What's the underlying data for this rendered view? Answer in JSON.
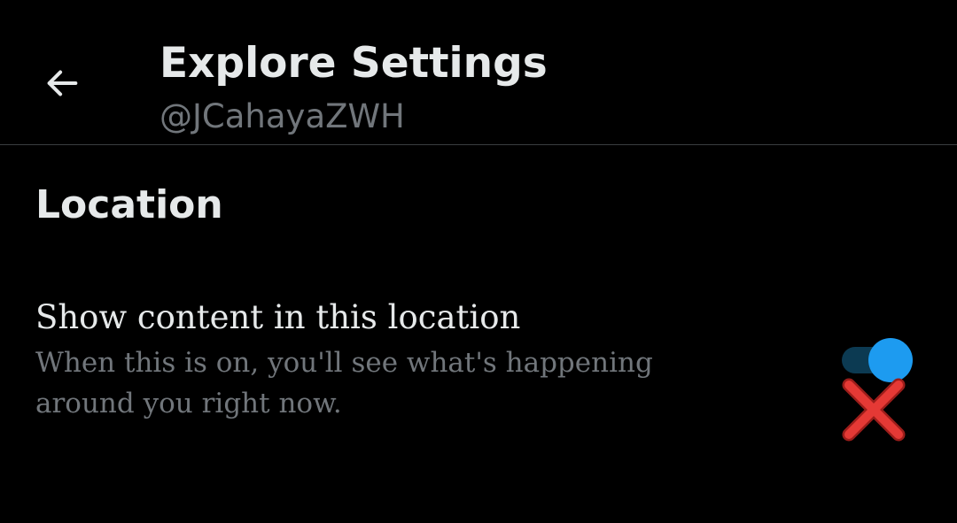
{
  "header": {
    "back_icon": "arrow-left-icon",
    "title": "Explore Settings",
    "subtitle": "@JCahayaZWH"
  },
  "section": {
    "heading": "Location"
  },
  "setting": {
    "label": "Show content in this location",
    "description": "When this is on, you'll see what's happening around you right now.",
    "toggle_on": true
  },
  "annotation": {
    "icon": "red-cross-mark-icon"
  },
  "colors": {
    "background": "#000000",
    "primary_text": "#e6e9ea",
    "secondary_text": "#71767b",
    "divider": "#3a3d40",
    "toggle_thumb": "#1d9bf0",
    "toggle_track": "#0c3a52",
    "cross": "#e53935"
  }
}
